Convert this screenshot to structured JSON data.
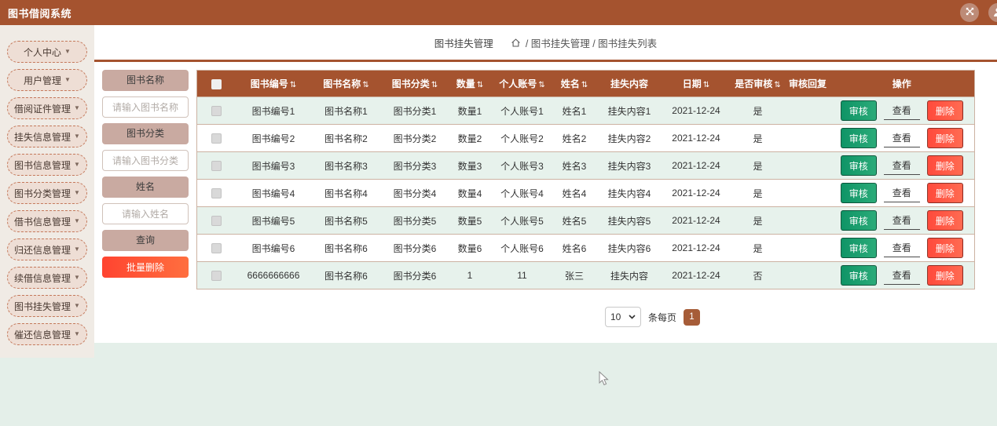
{
  "app": {
    "title": "图书借阅系统"
  },
  "colors": {
    "primary": "#a5532f",
    "page_background": "#e4efe9",
    "sidebar_background": "#f0ebe5",
    "row_alternate": "#e7f2ec",
    "filter_pill": "#c9aaa1",
    "review_green": "#18a06e",
    "delete_red": "#ff5140"
  },
  "header": {
    "icons": [
      {
        "name": "fullscreen"
      },
      {
        "name": "user"
      }
    ]
  },
  "sidebar": {
    "items": [
      {
        "label": "个人中心"
      },
      {
        "label": "用户管理"
      },
      {
        "label": "借阅证件管理"
      },
      {
        "label": "挂失信息管理"
      },
      {
        "label": "图书信息管理"
      },
      {
        "label": "图书分类管理"
      },
      {
        "label": "借书信息管理"
      },
      {
        "label": "归还信息管理"
      },
      {
        "label": "续借信息管理"
      },
      {
        "label": "图书挂失管理"
      },
      {
        "label": "催还信息管理"
      }
    ]
  },
  "breadcrumb": {
    "title": "图书挂失管理",
    "path": "/ 图书挂失管理 / 图书挂失列表"
  },
  "filters": [
    {
      "label": "图书名称",
      "placeholder": "请输入图书名称",
      "value": ""
    },
    {
      "label": "图书分类",
      "placeholder": "请输入图书分类",
      "value": ""
    },
    {
      "label": "姓名",
      "placeholder": "请输入姓名",
      "value": ""
    }
  ],
  "filter_buttons": {
    "search_label": "查询",
    "batch_delete_label": "批量删除"
  },
  "table": {
    "columns": [
      {
        "label": "图书编号",
        "sortable": true
      },
      {
        "label": "图书名称",
        "sortable": true
      },
      {
        "label": "图书分类",
        "sortable": true
      },
      {
        "label": "数量",
        "sortable": true
      },
      {
        "label": "个人账号",
        "sortable": true
      },
      {
        "label": "姓名",
        "sortable": true
      },
      {
        "label": "挂失内容",
        "sortable": false
      },
      {
        "label": "日期",
        "sortable": true
      },
      {
        "label": "是否审核",
        "sortable": true
      },
      {
        "label": "审核回复",
        "sortable": false
      },
      {
        "label": "操作",
        "sortable": false
      }
    ],
    "actions": {
      "review": "审核",
      "view": "查看",
      "delete": "删除"
    },
    "rows": [
      {
        "cells": [
          "图书编号1",
          "图书名称1",
          "图书分类1",
          "数量1",
          "个人账号1",
          "姓名1",
          "挂失内容1",
          "2021-12-24",
          "是",
          ""
        ]
      },
      {
        "cells": [
          "图书编号2",
          "图书名称2",
          "图书分类2",
          "数量2",
          "个人账号2",
          "姓名2",
          "挂失内容2",
          "2021-12-24",
          "是",
          ""
        ]
      },
      {
        "cells": [
          "图书编号3",
          "图书名称3",
          "图书分类3",
          "数量3",
          "个人账号3",
          "姓名3",
          "挂失内容3",
          "2021-12-24",
          "是",
          ""
        ]
      },
      {
        "cells": [
          "图书编号4",
          "图书名称4",
          "图书分类4",
          "数量4",
          "个人账号4",
          "姓名4",
          "挂失内容4",
          "2021-12-24",
          "是",
          ""
        ]
      },
      {
        "cells": [
          "图书编号5",
          "图书名称5",
          "图书分类5",
          "数量5",
          "个人账号5",
          "姓名5",
          "挂失内容5",
          "2021-12-24",
          "是",
          ""
        ]
      },
      {
        "cells": [
          "图书编号6",
          "图书名称6",
          "图书分类6",
          "数量6",
          "个人账号6",
          "姓名6",
          "挂失内容6",
          "2021-12-24",
          "是",
          ""
        ]
      },
      {
        "cells": [
          "6666666666",
          "图书名称6",
          "图书分类6",
          "1",
          "11",
          "张三",
          "挂失内容",
          "2021-12-24",
          "否",
          ""
        ]
      }
    ]
  },
  "pagination": {
    "page_size": "10",
    "per_page_label": "条每页",
    "current_page": "1"
  }
}
